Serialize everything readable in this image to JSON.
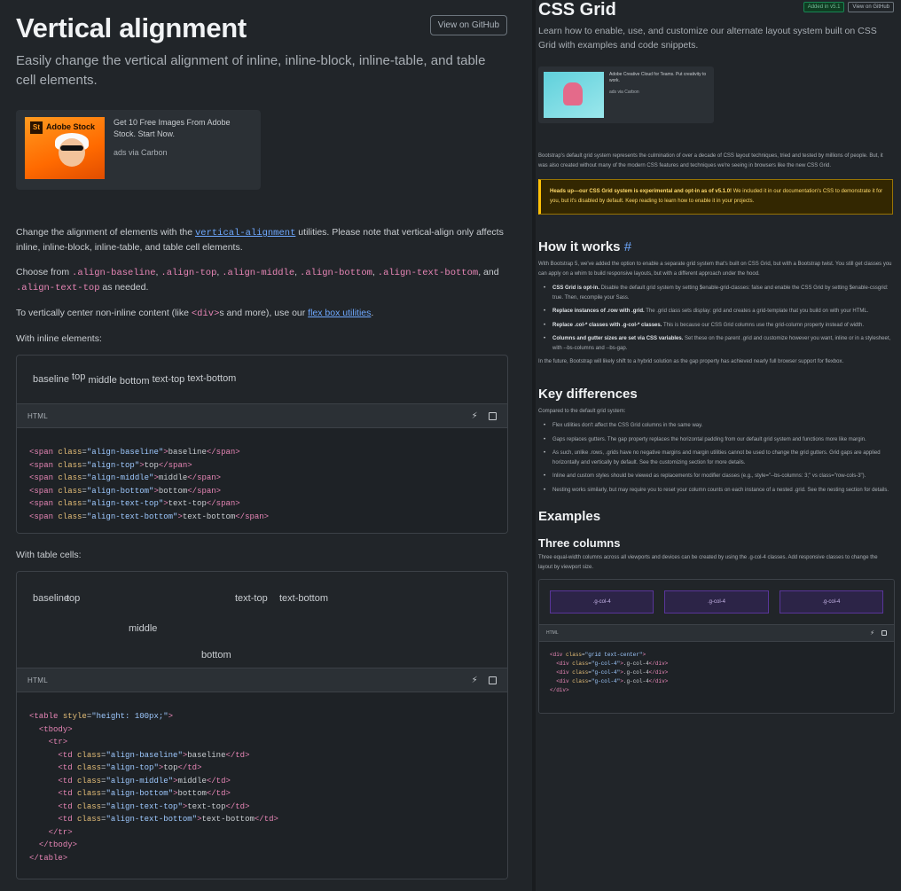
{
  "left": {
    "title": "Vertical alignment",
    "github_button": "View on GitHub",
    "lead": "Easily change the vertical alignment of inline, inline-block, inline-table, and table cell elements.",
    "ad": {
      "brand_badge": "St",
      "brand_name": "Adobe Stock",
      "text": "Get 10 Free Images From Adobe Stock. Start Now.",
      "via": "ads via Carbon"
    },
    "p1_before": "Change the alignment of elements with the ",
    "p1_link": "vertical-alignment",
    "p1_after": " utilities. Please note that vertical-align only affects inline, inline-block, inline-table, and table cell elements.",
    "p2_before": "Choose from ",
    "p2_codes": [
      ".align-baseline",
      ".align-top",
      ".align-middle",
      ".align-bottom",
      ".align-text-bottom",
      ".align-text-top"
    ],
    "p2_after": " as needed.",
    "p3_before": "To vertically center non-inline content (like ",
    "p3_code": "<div>",
    "p3_mid": "s and more), use our ",
    "p3_link": "flex box utilities",
    "p3_after": ".",
    "inline_label": "With inline elements:",
    "inline_demo": [
      "baseline",
      "top",
      "middle",
      "bottom",
      "text-top",
      "text-bottom"
    ],
    "lang": "HTML",
    "inline_code": [
      {
        "cls": "align-baseline",
        "txt": "baseline"
      },
      {
        "cls": "align-top",
        "txt": "top"
      },
      {
        "cls": "align-middle",
        "txt": "middle"
      },
      {
        "cls": "align-bottom",
        "txt": "bottom"
      },
      {
        "cls": "align-text-top",
        "txt": "text-top"
      },
      {
        "cls": "align-text-bottom",
        "txt": "text-bottom"
      }
    ],
    "table_label": "With table cells:",
    "table_demo": [
      "baseline",
      "top",
      "middle",
      "bottom",
      "text-top",
      "text-bottom"
    ],
    "table_code_open": "height: 100px;"
  },
  "right": {
    "title": "CSS Grid",
    "badge_added": "Added in v5.1",
    "github_button": "View on GitHub",
    "lead": "Learn how to enable, use, and customize our alternate layout system built on CSS Grid with examples and code snippets.",
    "ad": {
      "text": "Adobe Creative Cloud for Teams. Put creativity to work.",
      "via": "ads via Carbon"
    },
    "intro": "Bootstrap's default grid system represents the culmination of over a decade of CSS layout techniques, tried and tested by millions of people. But, it was also created without many of the modern CSS features and techniques we're seeing in browsers like the new CSS Grid.",
    "alert_bold": "Heads up—our CSS Grid system is experimental and opt-in as of v5.1.0!",
    "alert_rest": " We included it in our documentation's CSS to demonstrate it for you, but it's disabled by default. Keep reading to learn how to enable it in your projects.",
    "how_title": "How it works",
    "how_intro": "With Bootstrap 5, we've added the option to enable a separate grid system that's built on CSS Grid, but with a Bootstrap twist. You still get classes you can apply on a whim to build responsive layouts, but with a different approach under the hood.",
    "how_items": [
      {
        "b": "CSS Grid is opt-in.",
        "t": " Disable the default grid system by setting $enable-grid-classes: false and enable the CSS Grid by setting $enable-cssgrid: true. Then, recompile your Sass."
      },
      {
        "b": "Replace instances of .row with .grid.",
        "t": " The .grid class sets display: grid and creates a grid-template that you build on with your HTML."
      },
      {
        "b": "Replace .col-* classes with .g-col-* classes.",
        "t": " This is because our CSS Grid columns use the grid-column property instead of width."
      },
      {
        "b": "Columns and gutter sizes are set via CSS variables.",
        "t": " Set these on the parent .grid and customize however you want, inline or in a stylesheet, with --bs-columns and --bs-gap."
      }
    ],
    "how_outro": "In the future, Bootstrap will likely shift to a hybrid solution as the gap property has achieved nearly full browser support for flexbox.",
    "key_title": "Key differences",
    "key_intro": "Compared to the default grid system:",
    "key_items": [
      "Flex utilities don't affect the CSS Grid columns in the same way.",
      "Gaps replaces gutters. The gap property replaces the horizontal padding from our default grid system and functions more like margin.",
      "As such, unlike .rows, .grids have no negative margins and margin utilities cannot be used to change the grid gutters. Grid gaps are applied horizontally and vertically by default. See the customizing section for more details.",
      "Inline and custom styles should be viewed as replacements for modifier classes (e.g., style=\"--bs-columns: 3;\" vs class=\"row-cols-3\").",
      "Nesting works similarly, but may require you to reset your column counts on each instance of a nested .grid. See the nesting section for details."
    ],
    "examples_title": "Examples",
    "three_title": "Three columns",
    "three_desc": "Three equal-width columns across all viewports and devices can be created by using the .g-col-4 classes. Add responsive classes to change the layout by viewport size.",
    "col_label": ".g-col-4",
    "lang": "HTML",
    "code_grid": "grid text-center",
    "code_col": "g-col-4",
    "code_txt": ".g-col-4"
  }
}
